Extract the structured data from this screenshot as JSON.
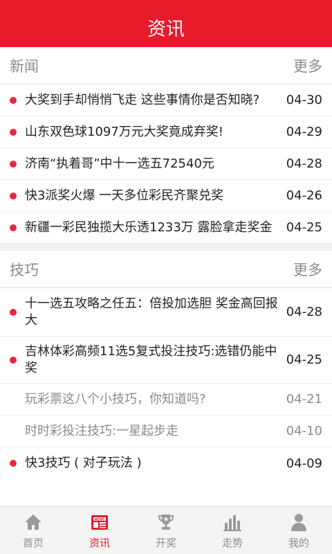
{
  "header": {
    "title": "资讯"
  },
  "news": {
    "title": "新闻",
    "more": "更多",
    "items": [
      {
        "title": "大奖到手却悄悄飞走 这些事情你是否知晓?",
        "date": "04-30",
        "unread": true
      },
      {
        "title": "山东双色球1097万元大奖竟成弃奖!",
        "date": "04-29",
        "unread": true
      },
      {
        "title": "济南“执着哥”中十一选五72540元",
        "date": "04-28",
        "unread": true
      },
      {
        "title": "快3派奖火爆 一天多位彩民齐聚兑奖",
        "date": "04-26",
        "unread": true
      },
      {
        "title": "新疆一彩民独揽大乐透1233万 露脸拿走奖金",
        "date": "04-25",
        "unread": true
      }
    ]
  },
  "tips": {
    "title": "技巧",
    "more": "更多",
    "items": [
      {
        "title": "十一选五攻略之任五：倍投加选胆 奖金高回报大",
        "date": "04-28",
        "unread": true
      },
      {
        "title": "吉林体彩高频11选5复式投注技巧:选错仍能中奖",
        "date": "04-25",
        "unread": true
      },
      {
        "title": "玩彩票这八个小技巧，你知道吗?",
        "date": "04-21",
        "unread": false
      },
      {
        "title": "时时彩投注技巧:一星起步走",
        "date": "04-10",
        "unread": false
      },
      {
        "title": "快3技巧 ( 对子玩法 )",
        "date": "04-09",
        "unread": true
      }
    ]
  },
  "tabbar": {
    "items": [
      {
        "label": "首页",
        "icon": "home-icon"
      },
      {
        "label": "资讯",
        "icon": "news-icon",
        "active": true
      },
      {
        "label": "开奖",
        "icon": "trophy-icon"
      },
      {
        "label": "走势",
        "icon": "bar-chart-icon"
      },
      {
        "label": "我的",
        "icon": "user-icon"
      }
    ]
  },
  "colors": {
    "brand": "#e8192b",
    "unread_dot": "#e8283b",
    "muted": "#8a8a8a"
  }
}
